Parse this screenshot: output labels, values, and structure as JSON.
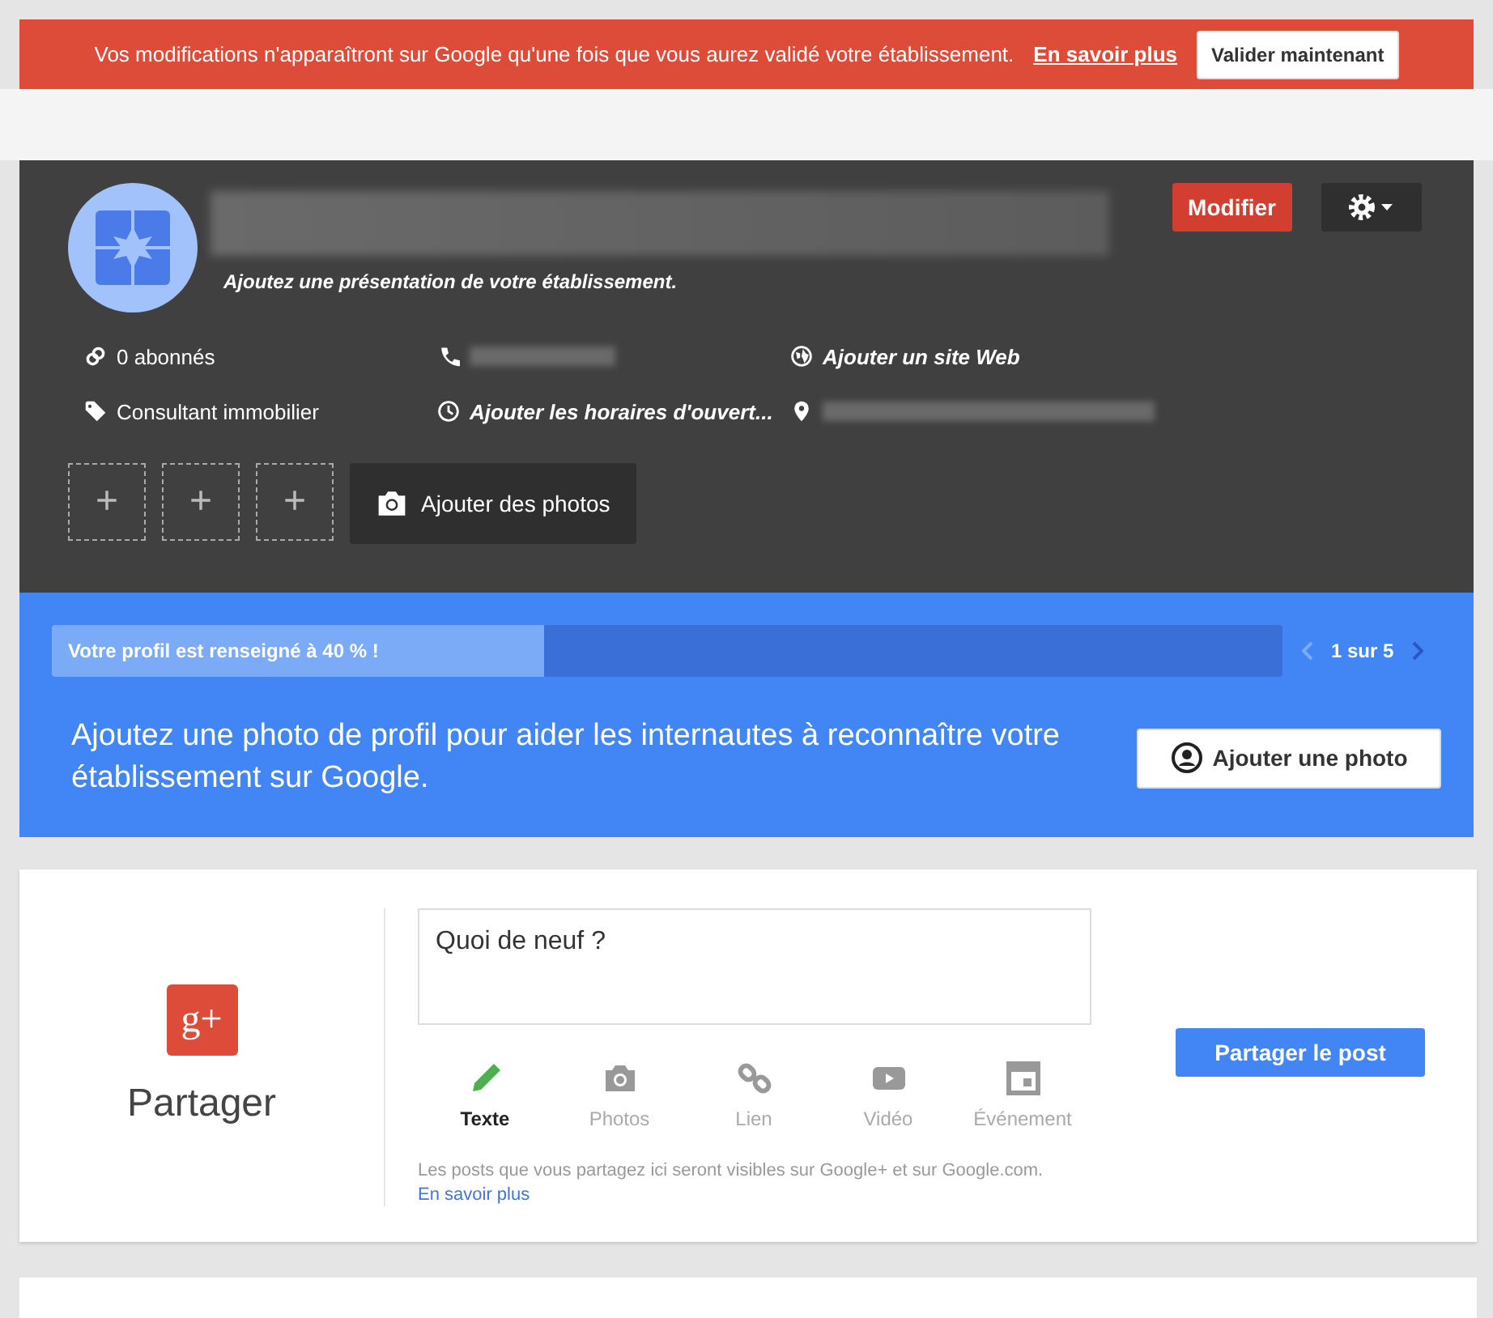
{
  "banner": {
    "message": "Vos modifications n'apparaîtront sur Google qu'une fois que vous aurez validé votre établissement.",
    "link": "En savoir plus",
    "button": "Valider maintenant"
  },
  "profile": {
    "tagline": "Ajoutez une présentation de votre établissement.",
    "edit_button": "Modifier",
    "details": [
      {
        "kind": "followers",
        "text": "0 abonnés",
        "prompt": false
      },
      {
        "kind": "phone"
      },
      {
        "kind": "website",
        "text": "Ajouter un site Web",
        "prompt": true
      },
      {
        "kind": "category",
        "text": "Consultant immobilier",
        "prompt": false
      },
      {
        "kind": "hours",
        "text": "Ajouter les horaires d'ouvert...",
        "prompt": true
      },
      {
        "kind": "address"
      }
    ],
    "photo_slots": [
      "+",
      "+",
      "+"
    ],
    "add_photos_button": "Ajouter des photos"
  },
  "progress": {
    "label": "Votre profil est renseigné à 40 % !",
    "level": 0.4,
    "pager": "1 sur 5",
    "tip": "Ajoutez une photo de profil pour aider les internautes à reconnaître votre établissement sur Google.",
    "button": "Ajouter une photo"
  },
  "share": {
    "logo": "g+",
    "title": "Partager",
    "placeholder": "Quoi de neuf ?",
    "tabs": [
      {
        "kind": "text",
        "label": "Texte",
        "selected": true
      },
      {
        "kind": "photos",
        "label": "Photos",
        "selected": false
      },
      {
        "kind": "link",
        "label": "Lien",
        "selected": false
      },
      {
        "kind": "video",
        "label": "Vidéo",
        "selected": false
      },
      {
        "kind": "event",
        "label": "Événement",
        "selected": false
      }
    ],
    "note": "Les posts que vous partagez ici seront visibles sur Google+ et sur Google.com.",
    "note_link": "En savoir plus",
    "button": "Partager le post"
  }
}
